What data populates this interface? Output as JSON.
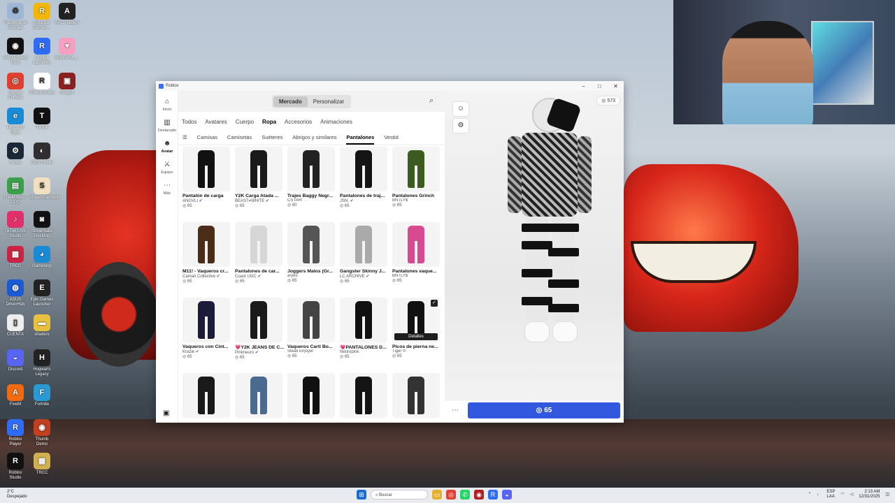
{
  "desktop": {
    "icons": [
      {
        "label": "Papelera de reciclaje",
        "color": "#9fb7d6",
        "glyph": "♻"
      },
      {
        "label": "Rockstar Games ...",
        "color": "#f2b705",
        "glyph": "R"
      },
      {
        "label": "ARC Raiders",
        "color": "#222",
        "glyph": "A"
      },
      {
        "label": "AMD Privacy View",
        "color": "#111",
        "glyph": "◉"
      },
      {
        "label": "Roblox Launcher",
        "color": "#2f6cf6",
        "glyph": "R"
      },
      {
        "label": "channels4_...",
        "color": "#f5a0c0",
        "glyph": "♥"
      },
      {
        "label": "Google Chrome",
        "color": "#e04030",
        "glyph": "◎"
      },
      {
        "label": "RobloxStudio",
        "color": "#fff",
        "glyph": "R"
      },
      {
        "label": "Imagen",
        "color": "#8a2020",
        "glyph": "▣"
      },
      {
        "label": "Microsoft Edge",
        "color": "#1a8ad4",
        "glyph": "e"
      },
      {
        "label": "TikTok",
        "color": "#111",
        "glyph": "T"
      },
      {
        "label": "Steam",
        "color": "#1b2838",
        "glyph": "⚙"
      },
      {
        "label": "OBS Studio",
        "color": "#302e31",
        "glyph": "◐"
      },
      {
        "label": "FiveM Plus - GPO",
        "color": "#3aa04a",
        "glyph": "▤"
      },
      {
        "label": "StreamElements",
        "color": "#f0e0c0",
        "glyph": "S"
      },
      {
        "label": "TikTok LIVE Studio",
        "color": "#e0306a",
        "glyph": "♪"
      },
      {
        "label": "Streamlabs Desktop",
        "color": "#111",
        "glyph": "◙"
      },
      {
        "label": "TRCC",
        "color": "#cc2244",
        "glyph": "▦"
      },
      {
        "label": "Gameloop",
        "color": "#1a8ad4",
        "glyph": "◕"
      },
      {
        "label": "ASUS DriverHub",
        "color": "#1a5ad4",
        "glyph": "◍"
      },
      {
        "label": "Epic Games Launcher",
        "color": "#222",
        "glyph": "E"
      },
      {
        "label": "CUENTA",
        "color": "#eee",
        "glyph": "▯"
      },
      {
        "label": "shaders",
        "color": "#e8c040",
        "glyph": "▬"
      },
      {
        "label": "Discord",
        "color": "#5865f2",
        "glyph": "◒"
      },
      {
        "label": "Hogwarts Legacy",
        "color": "#222",
        "glyph": "H"
      },
      {
        "label": "FiveM",
        "color": "#f06a10",
        "glyph": "A"
      },
      {
        "label": "Fortnite",
        "color": "#2a9ad4",
        "glyph": "F"
      },
      {
        "label": "Roblox Player",
        "color": "#2f6cf6",
        "glyph": "R"
      },
      {
        "label": "Thumb Demo",
        "color": "#c04020",
        "glyph": "◉"
      },
      {
        "label": "Roblox Studio",
        "color": "#111",
        "glyph": "R"
      },
      {
        "label": "TRCC",
        "color": "#d0b050",
        "glyph": "▦"
      }
    ]
  },
  "window": {
    "title": "Roblox",
    "controls": [
      "–",
      "□",
      "✕"
    ]
  },
  "rail": {
    "items": [
      {
        "label": "Inicio",
        "icon": "⌂",
        "active": false
      },
      {
        "label": "Destacado",
        "icon": "▥",
        "active": false
      },
      {
        "label": "Avatar",
        "icon": "☻",
        "active": true
      },
      {
        "label": "Equipo",
        "icon": "⚔",
        "active": false
      },
      {
        "label": "Más",
        "icon": "⋯",
        "active": false
      }
    ],
    "bottom_icon": "▣"
  },
  "topbar": {
    "toggle": [
      "Mercado",
      "Personalizar"
    ],
    "selected": "Mercado"
  },
  "categories": [
    "Todos",
    "Avatares",
    "Cuerpo",
    "Ropa",
    "Accesorios",
    "Animaciones"
  ],
  "selected_category": "Ropa",
  "subcategories": [
    "Camisas",
    "Camisetas",
    "Suéteres",
    "Abrigos y similares",
    "Pantalones",
    "Vestid"
  ],
  "selected_subcategory": "Pantalones",
  "items": [
    {
      "name": "Pantalón de carga",
      "creator": "ANGVLI",
      "verified": true,
      "price": "65",
      "color": "#111"
    },
    {
      "name": "Y2K Carga Atada ...",
      "creator": "BEAST≠WHITE",
      "verified": true,
      "price": "65",
      "color": "#1a1a1a"
    },
    {
      "name": "Trajes Baggy Negr...",
      "creator": "CSTAR!",
      "verified": false,
      "price": "60",
      "color": "#222"
    },
    {
      "name": "Pantalones de traj...",
      "creator": "JSN.",
      "verified": true,
      "price": "65",
      "color": "#151515"
    },
    {
      "name": "Pantalones Grinch",
      "creator": "BNTLY$",
      "verified": false,
      "price": "65",
      "color": "#3d5a20"
    },
    {
      "name": "M11! - Vaqueros cr...",
      "creator": "Camari Collective",
      "verified": true,
      "price": "65",
      "color": "#4a2c18"
    },
    {
      "name": "Pantalones de car...",
      "creator": "Coast UGC",
      "verified": true,
      "price": "65",
      "color": "#d6d6d6"
    },
    {
      "name": "Joggers Malos (Gr...",
      "creator": "aryes",
      "verified": false,
      "price": "65",
      "color": "#555"
    },
    {
      "name": "Gangster Skinny J...",
      "creator": "LC ARCHIVE",
      "verified": true,
      "price": "65",
      "color": "#aaa"
    },
    {
      "name": "Pantalones vaque...",
      "creator": "BNTLY$",
      "verified": false,
      "price": "65",
      "color": "#d84a90"
    },
    {
      "name": "Vaqueros con Cint...",
      "creator": "Krazie",
      "verified": true,
      "price": "65",
      "color": "#1c1c3a"
    },
    {
      "name": "💗Y2K JEANS DE C...",
      "creator": "Pinkneuro",
      "verified": true,
      "price": "65",
      "color": "#1a1a1a"
    },
    {
      "name": "Vaqueros Carti Bo...",
      "creator": "Steak Enjoyer",
      "verified": false,
      "price": "65",
      "color": "#444"
    },
    {
      "name": "💗PANTALONES D...",
      "creator": "Neuropink",
      "verified": false,
      "price": "65",
      "color": "#111"
    },
    {
      "name": "Picos de pierna ne...",
      "creator": "Tiger ®",
      "verified": false,
      "price": "65",
      "color": "#111",
      "selected": true,
      "detail_label": "Detalles"
    },
    {
      "name": "",
      "creator": "",
      "verified": false,
      "price": "",
      "color": "#1a1a1a"
    },
    {
      "name": "",
      "creator": "",
      "verified": false,
      "price": "",
      "color": "#4a6a90"
    },
    {
      "name": "",
      "creator": "",
      "verified": false,
      "price": "",
      "color": "#111"
    },
    {
      "name": "",
      "creator": "",
      "verified": false,
      "price": "",
      "color": "#141414"
    },
    {
      "name": "",
      "creator": "",
      "verified": false,
      "price": "",
      "color": "#333"
    }
  ],
  "viewer": {
    "robux_balance": "573",
    "buy_price": "65"
  },
  "taskbar": {
    "weather_temp": "2°C",
    "weather_desc": "Despejado",
    "search_placeholder": "Buscar",
    "lang": "ESP",
    "lang_region": "LAA",
    "time": "2:13 AM",
    "date": "12/31/2025"
  }
}
